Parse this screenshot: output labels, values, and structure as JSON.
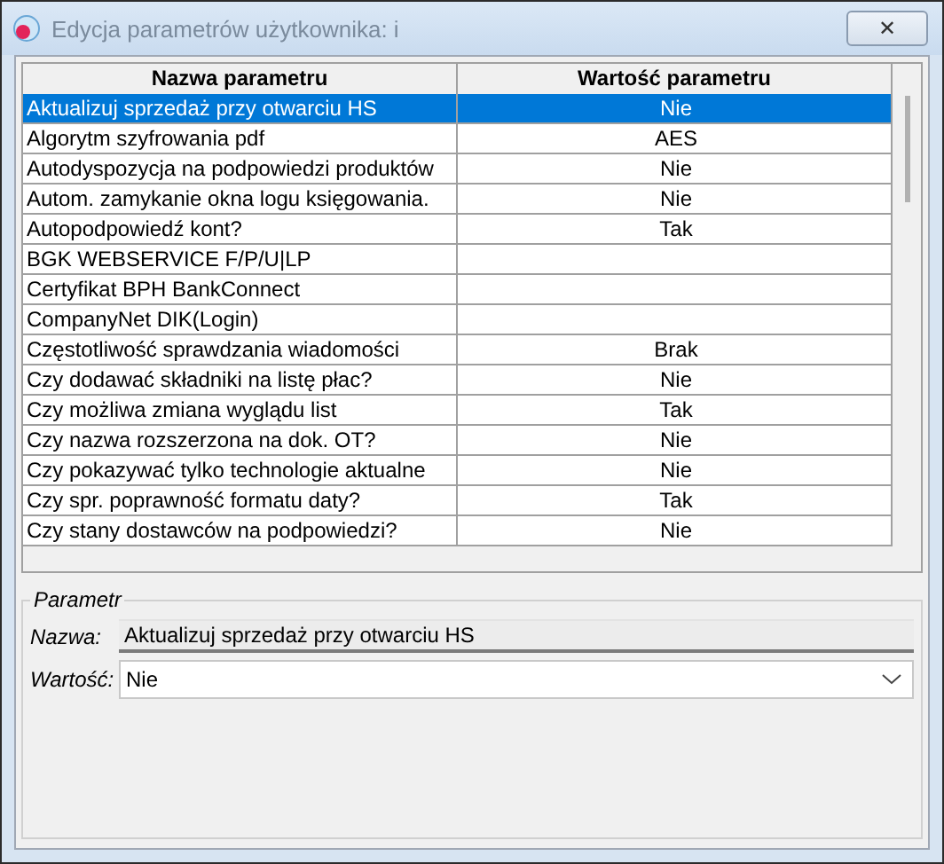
{
  "window": {
    "title": "Edycja parametrów użytkownika: i",
    "close": "✕"
  },
  "table": {
    "columns": [
      "Nazwa parametru",
      "Wartość parametru"
    ],
    "rows": [
      {
        "name": "Aktualizuj sprzedaż przy otwarciu HS",
        "value": "Nie",
        "selected": true
      },
      {
        "name": "Algorytm szyfrowania pdf",
        "value": "AES",
        "selected": false
      },
      {
        "name": "Autodyspozycja na podpowiedzi produktów",
        "value": "Nie",
        "selected": false
      },
      {
        "name": "Autom. zamykanie okna logu księgowania.",
        "value": "Nie",
        "selected": false
      },
      {
        "name": "Autopodpowiedź kont?",
        "value": "Tak",
        "selected": false
      },
      {
        "name": "BGK WEBSERVICE F/P/U|LP",
        "selected": false
      },
      {
        "name": "Certyfikat BPH BankConnect",
        "selected": false
      },
      {
        "name": "CompanyNet DIK(Login)",
        "selected": false
      },
      {
        "name": "Częstotliwość sprawdzania wiadomości",
        "value": "Brak",
        "selected": false
      },
      {
        "name": "Czy dodawać składniki na listę płac?",
        "value": "Nie",
        "selected": false
      },
      {
        "name": "Czy możliwa zmiana wyglądu list",
        "value": "Tak",
        "selected": false
      },
      {
        "name": "Czy nazwa rozszerzona na dok. OT?",
        "value": "Nie",
        "selected": false
      },
      {
        "name": "Czy pokazywać tylko technologie aktualne",
        "value": "Nie",
        "selected": false
      },
      {
        "name": "Czy spr. poprawność formatu daty?",
        "value": "Tak",
        "selected": false
      },
      {
        "name": "Czy stany dostawców na podpowiedzi?",
        "value": "Nie",
        "selected": false
      }
    ]
  },
  "parameter": {
    "legend": "Parametr",
    "name_label": "Nazwa:",
    "name_value": "Aktualizuj sprzedaż przy otwarciu HS",
    "value_label": "Wartość:",
    "value": "Nie"
  }
}
